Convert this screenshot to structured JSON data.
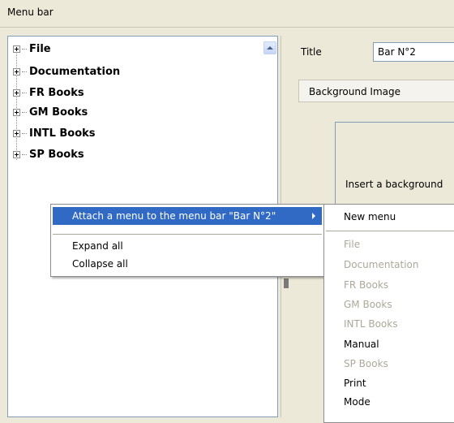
{
  "header": {
    "title": "Menu bar"
  },
  "tree": {
    "items": [
      {
        "label": "File"
      },
      {
        "label": "Documentation"
      },
      {
        "label": "FR Books"
      },
      {
        "label": "GM Books"
      },
      {
        "label": "INTL Books"
      },
      {
        "label": "SP Books"
      }
    ]
  },
  "form": {
    "title_label": "Title",
    "title_value": "Bar N°2",
    "background_tab": "Background Image",
    "insert_text": "Insert a background"
  },
  "context_menu": {
    "attach": "Attach a menu to the menu bar \"Bar N°2\"",
    "expand_all": "Expand all",
    "collapse_all": "Collapse all"
  },
  "submenu": {
    "new_menu": "New menu",
    "items": [
      {
        "label": "File",
        "enabled": false
      },
      {
        "label": "Documentation",
        "enabled": false
      },
      {
        "label": "FR Books",
        "enabled": false
      },
      {
        "label": "GM Books",
        "enabled": false
      },
      {
        "label": "INTL Books",
        "enabled": false
      },
      {
        "label": "Manual",
        "enabled": true
      },
      {
        "label": "SP Books",
        "enabled": false
      },
      {
        "label": "Print",
        "enabled": true
      },
      {
        "label": "Mode",
        "enabled": true
      }
    ]
  },
  "colors": {
    "highlight": "#316ac5",
    "disabled_text": "#aca899",
    "window_bg": "#ece9d8"
  }
}
